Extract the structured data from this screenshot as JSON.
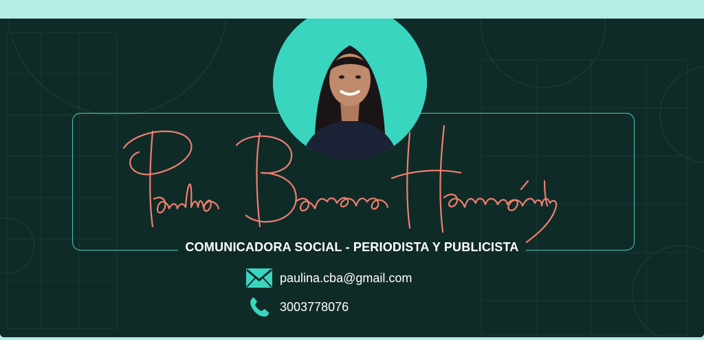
{
  "name": "Paulina Barrera Hernández",
  "title": "COMUNICADORA SOCIAL - PERIODISTA Y PUBLICISTA",
  "contacts": {
    "email": "paulina.cba@gmail.com",
    "phone": "3003778076"
  },
  "colors": {
    "accent": "#3ad5bf",
    "signature": "#f07f6e",
    "background": "#0f2b28",
    "top_band": "#b4ede4"
  },
  "icons": [
    "mail-icon",
    "phone-icon"
  ]
}
